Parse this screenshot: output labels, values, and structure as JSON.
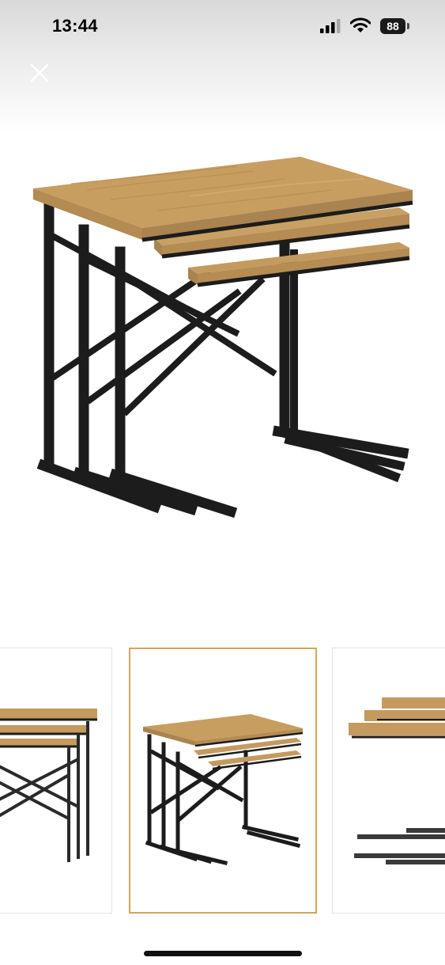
{
  "status_bar": {
    "time": "13:44",
    "battery_level": "88",
    "signal_icon": "cellular-signal-icon",
    "wifi_icon": "wifi-icon"
  },
  "controls": {
    "close_icon": "close-icon"
  },
  "gallery": {
    "main_image": "nesting-side-tables-image",
    "thumbnails": [
      {
        "name": "thumbnail-side-view",
        "selected": false
      },
      {
        "name": "thumbnail-nesting-tables",
        "selected": true
      },
      {
        "name": "thumbnail-parts-view",
        "selected": false
      }
    ]
  },
  "colors": {
    "wood": "#c49a5f",
    "metal": "#1c1c1c",
    "selected_border": "#d9a35a"
  }
}
